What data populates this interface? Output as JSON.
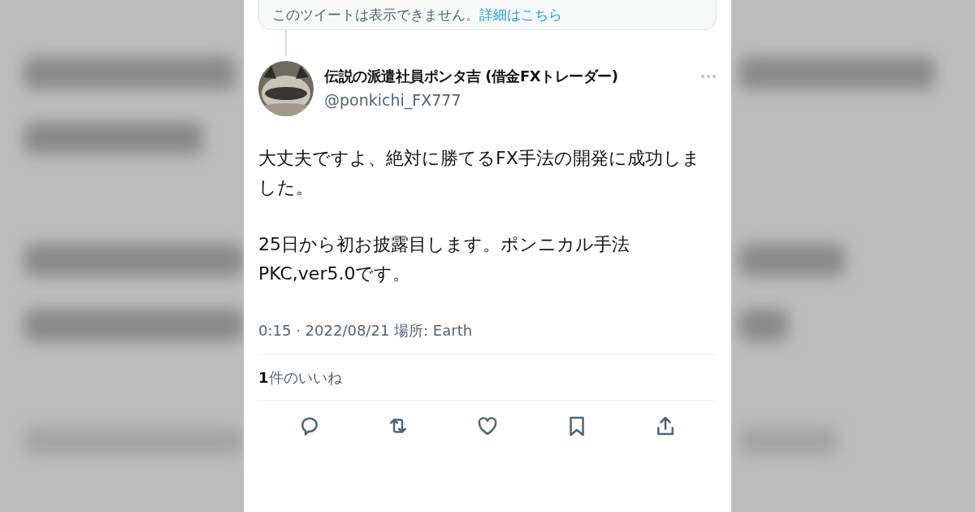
{
  "quoted_notice": {
    "text": "このツイートは表示できません。",
    "link": "詳細はこちら"
  },
  "author": {
    "name": "伝説の派遣社員ポンタ吉 (借金FXトレーダー)",
    "handle": "@ponkichi_FX777"
  },
  "body": [
    "大丈夫ですよ、絶対に勝てるFX手法の開発に成功しました。",
    "25日から初お披露目します。ポンニカル手法PKC,ver5.0です。"
  ],
  "meta": "0:15 · 2022/08/21 場所: Earth",
  "likes": "**1**件のいいね",
  "actions": [
    {
      "kind": "reply"
    },
    {
      "kind": "retweet"
    },
    {
      "kind": "like"
    },
    {
      "kind": "bookmark"
    },
    {
      "kind": "share"
    }
  ]
}
